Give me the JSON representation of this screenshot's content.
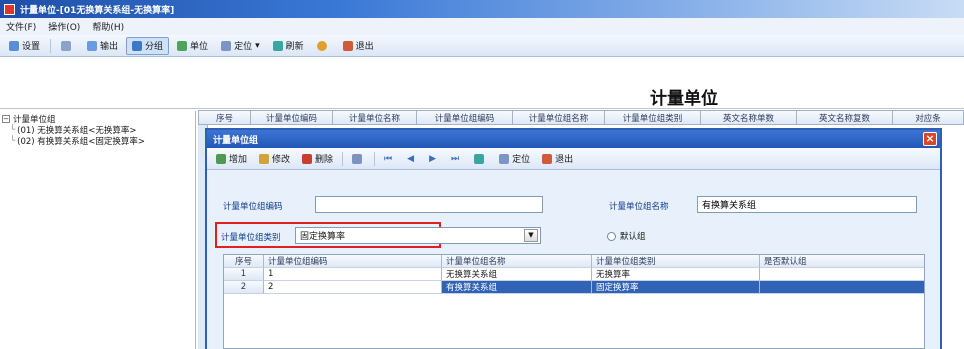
{
  "window": {
    "title": "计量单位-[01无换算关系组-无换算率]"
  },
  "menu": {
    "items": [
      "文件(F)",
      "操作(O)",
      "帮助(H)"
    ]
  },
  "toolbar": {
    "items": [
      {
        "label": "设置",
        "icon": "settings-icon"
      },
      {
        "label": "",
        "icon": "print-icon"
      },
      {
        "label": "输出",
        "icon": "export-icon"
      },
      {
        "label": "分组",
        "icon": "group-icon",
        "active": true
      },
      {
        "label": "单位",
        "icon": "unit-icon"
      },
      {
        "label": "定位",
        "icon": "locate-icon"
      },
      {
        "label": "刷新",
        "icon": "refresh-icon"
      },
      {
        "label": "",
        "icon": "help-icon"
      },
      {
        "label": "退出",
        "icon": "exit-icon"
      }
    ]
  },
  "page": {
    "title": "计量单位"
  },
  "tree": {
    "root": "计量单位组",
    "children": [
      "(01) 无换算关系组<无换算率>",
      "(02) 有换算关系组<固定换算率>"
    ]
  },
  "grid": {
    "columns": [
      "序号",
      "计量单位编码",
      "计量单位名称",
      "计量单位组编码",
      "计量单位组名称",
      "计量单位组类别",
      "英文名称单数",
      "英文名称复数",
      "对应条"
    ]
  },
  "dialog": {
    "title": "计量单位组",
    "toolbar": [
      {
        "label": "增加",
        "icon": "add-icon"
      },
      {
        "label": "修改",
        "icon": "edit-icon"
      },
      {
        "label": "删除",
        "icon": "delete-icon"
      },
      {
        "label": "",
        "icon": "save-icon"
      },
      {
        "label": "",
        "icon": "first-icon"
      },
      {
        "label": "",
        "icon": "prev-icon"
      },
      {
        "label": "",
        "icon": "next-icon"
      },
      {
        "label": "",
        "icon": "last-icon"
      },
      {
        "label": "",
        "icon": "refresh-icon"
      },
      {
        "label": "定位",
        "icon": "locate-icon"
      },
      {
        "label": "退出",
        "icon": "exit-icon"
      }
    ],
    "fields": {
      "group_code_label": "计量单位组编码",
      "group_code_value": "",
      "group_name_label": "计量单位组名称",
      "group_name_value": "有换算关系组",
      "group_type_label": "计量单位组类别",
      "group_type_value": "固定换算率",
      "default_label": "默认组"
    },
    "table": {
      "columns": [
        "序号",
        "计量单位组编码",
        "计量单位组名称",
        "计量单位组类别",
        "是否默认组"
      ],
      "rows": [
        [
          "1",
          "1",
          "无换算关系组",
          "无换算率",
          ""
        ],
        [
          "2",
          "2",
          "有换算关系组",
          "固定换算率",
          ""
        ]
      ],
      "selected_row": 2
    }
  }
}
